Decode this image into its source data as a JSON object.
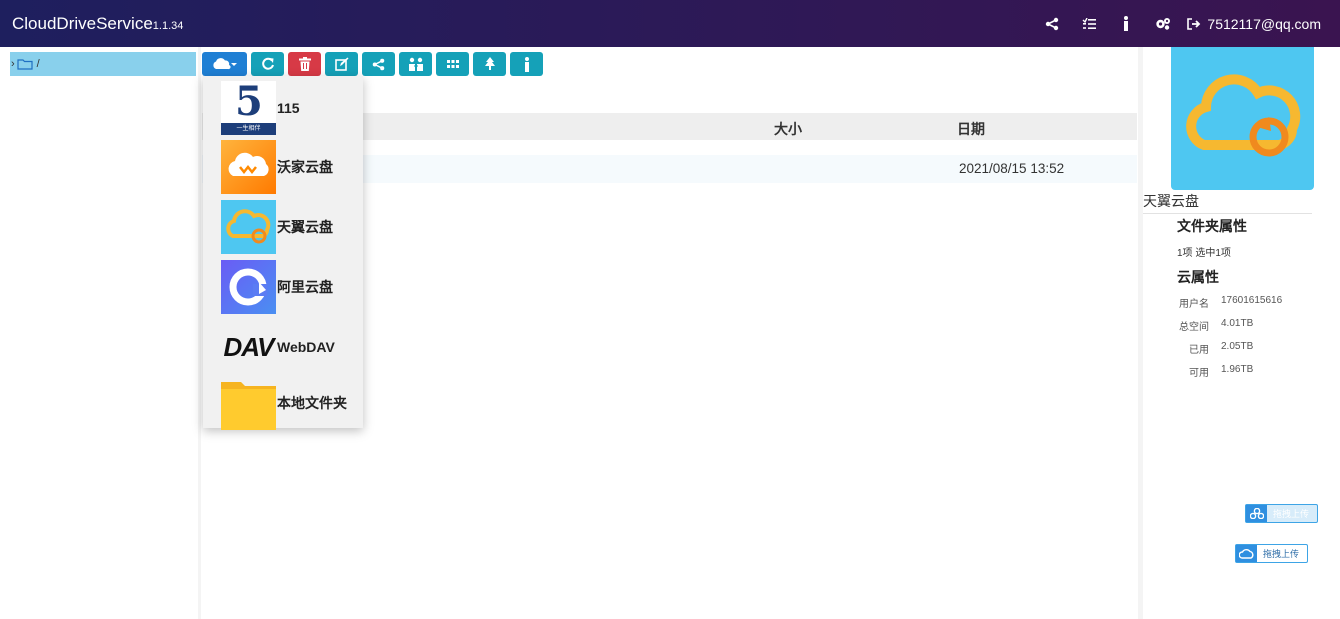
{
  "header": {
    "brand": "CloudDriveService",
    "version": "1.1.34",
    "user": "7512117@qq.com"
  },
  "tree": {
    "root_label": "/"
  },
  "table": {
    "col_size": "大小",
    "col_date": "日期",
    "rows": [
      {
        "date": "2021/08/15 13:52"
      }
    ]
  },
  "dropdown": {
    "items": [
      {
        "label": "115",
        "icon": "115-logo-icon"
      },
      {
        "label": "沃家云盘",
        "icon": "wojia-cloud-icon"
      },
      {
        "label": "天翼云盘",
        "icon": "tianyi-cloud-icon"
      },
      {
        "label": "阿里云盘",
        "icon": "aliyun-drive-icon"
      },
      {
        "label": "WebDAV",
        "icon": "webdav-logo-icon"
      },
      {
        "label": "本地文件夹",
        "icon": "local-folder-icon"
      }
    ],
    "logo_115_top": "5",
    "logo_115_bottom": "一生相伴",
    "logo_dav": "DAV"
  },
  "panel": {
    "cloud_name": "天翼云盘",
    "folder_props_title": "文件夹属性",
    "folder_props_text": "1项  选中1项",
    "cloud_props_title": "云属性",
    "props": [
      {
        "key": "用户名",
        "value": "17601615616"
      },
      {
        "key": "总空间",
        "value": "4.01TB"
      },
      {
        "key": "已用",
        "value": "2.05TB"
      },
      {
        "key": "可用",
        "value": "1.96TB"
      }
    ],
    "upload_label": "拖拽上传"
  },
  "colors": {
    "header_left": "#1e1f5e",
    "header_right": "#3a1450",
    "toolbar_teal": "#15a1b8",
    "toolbar_blue": "#1f7fd4",
    "toolbar_red": "#d73a46",
    "tree_selected": "#89d0ec",
    "hero_bg": "#4ec7f1"
  }
}
